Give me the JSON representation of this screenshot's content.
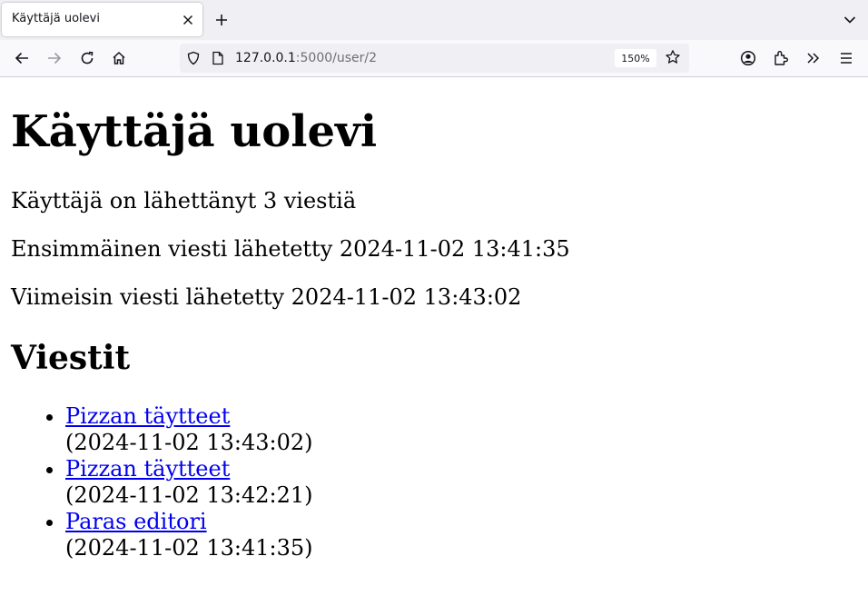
{
  "browser": {
    "tab": {
      "title": "Käyttäjä uolevi"
    },
    "url": {
      "host": "127.0.0.1",
      "rest": ":5000/user/2"
    },
    "zoom": "150%"
  },
  "page": {
    "heading": "Käyttäjä uolevi",
    "summary": {
      "count_line": "Käyttäjä on lähettänyt 3 viestiä",
      "first_line": "Ensimmäinen viesti lähetetty 2024-11-02 13:41:35",
      "last_line": "Viimeisin viesti lähetetty 2024-11-02 13:43:02"
    },
    "posts_heading": "Viestit",
    "posts": [
      {
        "title": "Pizzan täytteet",
        "time": "(2024-11-02 13:43:02)"
      },
      {
        "title": "Pizzan täytteet",
        "time": "(2024-11-02 13:42:21)"
      },
      {
        "title": "Paras editori",
        "time": "(2024-11-02 13:41:35)"
      }
    ]
  }
}
